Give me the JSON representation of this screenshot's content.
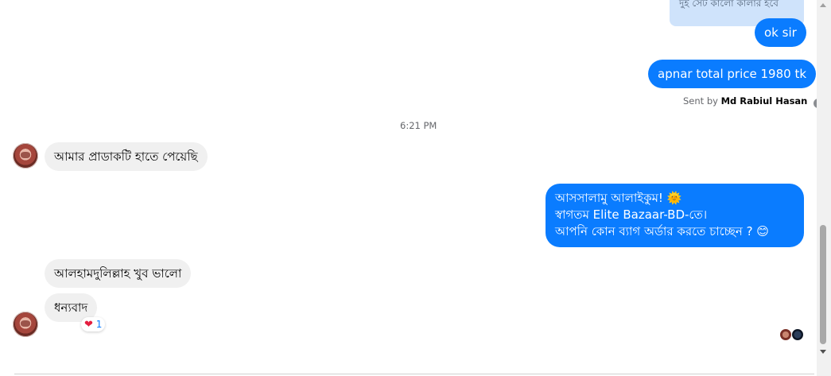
{
  "colors": {
    "outgoing_bubble": "#0a7cff",
    "incoming_bubble": "#f0f0f0",
    "quoted_bubble": "#cfe3fb",
    "reaction_heart": "#e41e3f"
  },
  "quoted_message": {
    "text": "দুই সেট কালো কালার হবে"
  },
  "messages": {
    "ok_sir": "ok sir",
    "total_price": "apnar total price 1980 tk",
    "received_product": "আমার প্রাডাকটি হাতে পেয়েছি",
    "greeting_line1": "আসসালামু আলাইকুম! 🌞",
    "greeting_line2": "স্বাগতম Elite Bazaar-BD-তে।",
    "greeting_line3": "আপনি কোন ব্যাগ অর্ডার করতে চাচ্ছেন ? 😊",
    "alhamdulillah": "আলহামদুলিল্লাহ খুব ভালো",
    "thanks": "ধন্যবাদ"
  },
  "sent_by": {
    "prefix": "Sent by",
    "name": "Md Rabiul Hasan",
    "help_icon": "?"
  },
  "timestamp": "6:21 PM",
  "reaction": {
    "emoji": "❤",
    "count": "1"
  },
  "icons": {
    "help": "help-circle-icon",
    "heart": "heart-icon"
  }
}
